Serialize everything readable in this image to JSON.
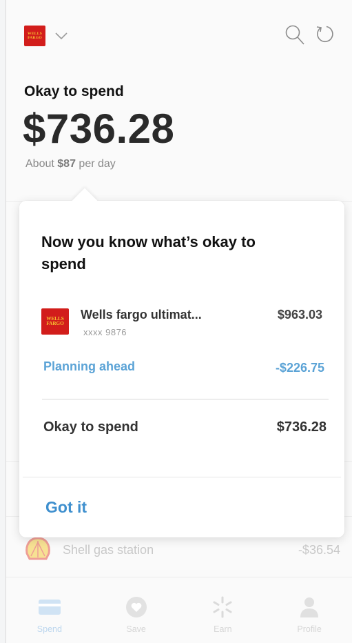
{
  "header": {
    "bank_logo_text": [
      "WELLS",
      "FARGO"
    ],
    "title": "Okay to spend",
    "amount": "$736.28",
    "per_day_prefix": "About ",
    "per_day_value": "$87",
    "per_day_suffix": " per day",
    "icons": [
      "chevron-down-icon",
      "search-icon",
      "refresh-icon"
    ]
  },
  "popover": {
    "title": "Now you know what’s okay to spend",
    "account": {
      "logo_text": [
        "WELLS",
        "FARGO"
      ],
      "name": "Wells fargo ultimat...",
      "mask": "xxxx 9876",
      "amount": "$963.03"
    },
    "planning": {
      "label": "Planning ahead",
      "amount": "-$226.75"
    },
    "okay_to_spend": {
      "label": "Okay to spend",
      "amount": "$736.28"
    },
    "got_it_label": "Got it"
  },
  "background_list": {
    "shell": {
      "name": "Shell gas station",
      "amount": "-$36.54"
    }
  },
  "bottom_nav": {
    "items": [
      {
        "label": "Spend",
        "icon": "card-icon",
        "active": true
      },
      {
        "label": "Save",
        "icon": "heart-icon",
        "active": false
      },
      {
        "label": "Earn",
        "icon": "sparkle-icon",
        "active": false
      },
      {
        "label": "Profile",
        "icon": "person-icon",
        "active": false
      }
    ]
  },
  "colors": {
    "brand_red": "#d21d1b",
    "brand_gold": "#f7c331",
    "accent_blue": "#3e8fce",
    "planning_blue": "#5ba3d6"
  }
}
